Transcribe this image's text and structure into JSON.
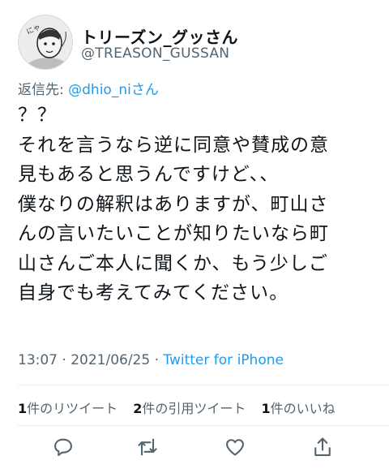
{
  "author": {
    "display_name": "トリーズン_グッさん",
    "handle": "@TREASON_GUSSAN",
    "avatar_text": "にゃ"
  },
  "reply_to": {
    "prefix": "返信先: ",
    "mention": "@dhio_niさん"
  },
  "tweet": {
    "lines": [
      "？？",
      "それを言うなら逆に同意や賛成の意",
      "見もあると思うんですけど、、",
      "僕なりの解釈はありますが、町山さ",
      "んの言いたいことが知りたいなら町",
      "山さんご本人に聞くか、もう少しご",
      "自身でも考えてみてください。"
    ]
  },
  "meta": {
    "time": "13:07 · 2021/06/25 · ",
    "source": "Twitter for iPhone"
  },
  "stats": {
    "retweets_count": "1",
    "retweets_label": "件のリツイート",
    "quotes_count": "2",
    "quotes_label": "件の引用ツイート",
    "likes_count": "1",
    "likes_label": "件のいいね"
  },
  "actions": {
    "icons": [
      "reply-icon",
      "retweet-icon",
      "like-icon",
      "share-icon"
    ],
    "color": "#536471"
  },
  "colors": {
    "link": "#1d9bf0",
    "secondary": "#536471",
    "divider": "#e6ecf0"
  }
}
